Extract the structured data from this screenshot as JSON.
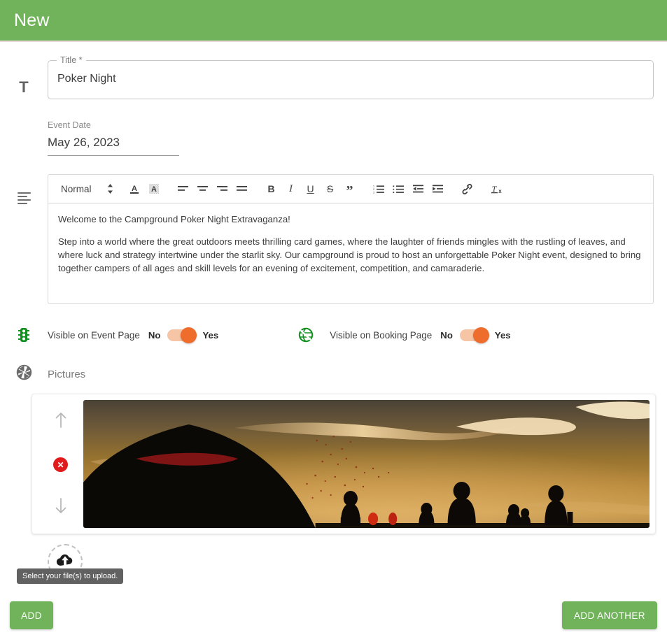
{
  "header": {
    "title": "New"
  },
  "fields": {
    "title": {
      "icon": "text-format-icon",
      "label": "Title *",
      "value": "Poker Night"
    },
    "event_date": {
      "label": "Event Date",
      "value": "May 26, 2023"
    }
  },
  "editor": {
    "icon": "text-lines-icon",
    "toolbar": {
      "format_select": "Normal",
      "buttons": [
        {
          "name": "text-color-icon",
          "label": "A"
        },
        {
          "name": "background-color-icon",
          "label": "A"
        },
        {
          "name": "align-left-icon",
          "label": "Align left"
        },
        {
          "name": "align-center-icon",
          "label": "Align center"
        },
        {
          "name": "align-right-icon",
          "label": "Align right"
        },
        {
          "name": "align-justify-icon",
          "label": "Justify"
        },
        {
          "name": "bold-icon",
          "label": "B"
        },
        {
          "name": "italic-icon",
          "label": "I"
        },
        {
          "name": "underline-icon",
          "label": "U"
        },
        {
          "name": "strikethrough-icon",
          "label": "S"
        },
        {
          "name": "blockquote-icon",
          "label": "”"
        },
        {
          "name": "ordered-list-icon",
          "label": "Ordered list"
        },
        {
          "name": "bullet-list-icon",
          "label": "Bullet list"
        },
        {
          "name": "outdent-icon",
          "label": "Outdent"
        },
        {
          "name": "indent-icon",
          "label": "Indent"
        },
        {
          "name": "link-icon",
          "label": "Link"
        },
        {
          "name": "clear-format-icon",
          "label": "Tx"
        }
      ]
    },
    "paragraphs": [
      "Welcome to the Campground Poker Night Extravaganza!",
      "Step into a world where the great outdoors meets thrilling card games, where the laughter of friends mingles with the rustling of leaves, and where luck and strategy intertwine under the starlit sky. Our campground is proud to host an unforgettable Poker Night event, designed to bring together campers of all ages and skill levels for an evening of excitement, competition, and camaraderie."
    ]
  },
  "toggles": [
    {
      "icon": "traffic-light-icon",
      "label": "Visible on Event Page",
      "off_label": "No",
      "on_label": "Yes",
      "state": "Yes"
    },
    {
      "icon": "globe-icon",
      "label": "Visible on Booking Page",
      "off_label": "No",
      "on_label": "Yes",
      "state": "Yes"
    }
  ],
  "pictures": {
    "icon": "aperture-icon",
    "label": "Pictures",
    "controls": {
      "move_up": "move-up-arrow",
      "remove": "✕",
      "move_down": "move-down-arrow"
    },
    "image_alt": "Silhouette of a tent and campers at sunset"
  },
  "upload": {
    "icon": "cloud-upload-icon",
    "tooltip": "Select your file(s) to upload."
  },
  "footer": {
    "add_label": "ADD",
    "add_another_label": "ADD ANOTHER"
  },
  "colors": {
    "brand_green": "#71b35b",
    "toggle_track": "#f6c5a6",
    "toggle_knob": "#ee6c2c",
    "delete_red": "#e01b1b",
    "tooltip_bg": "#616161"
  }
}
